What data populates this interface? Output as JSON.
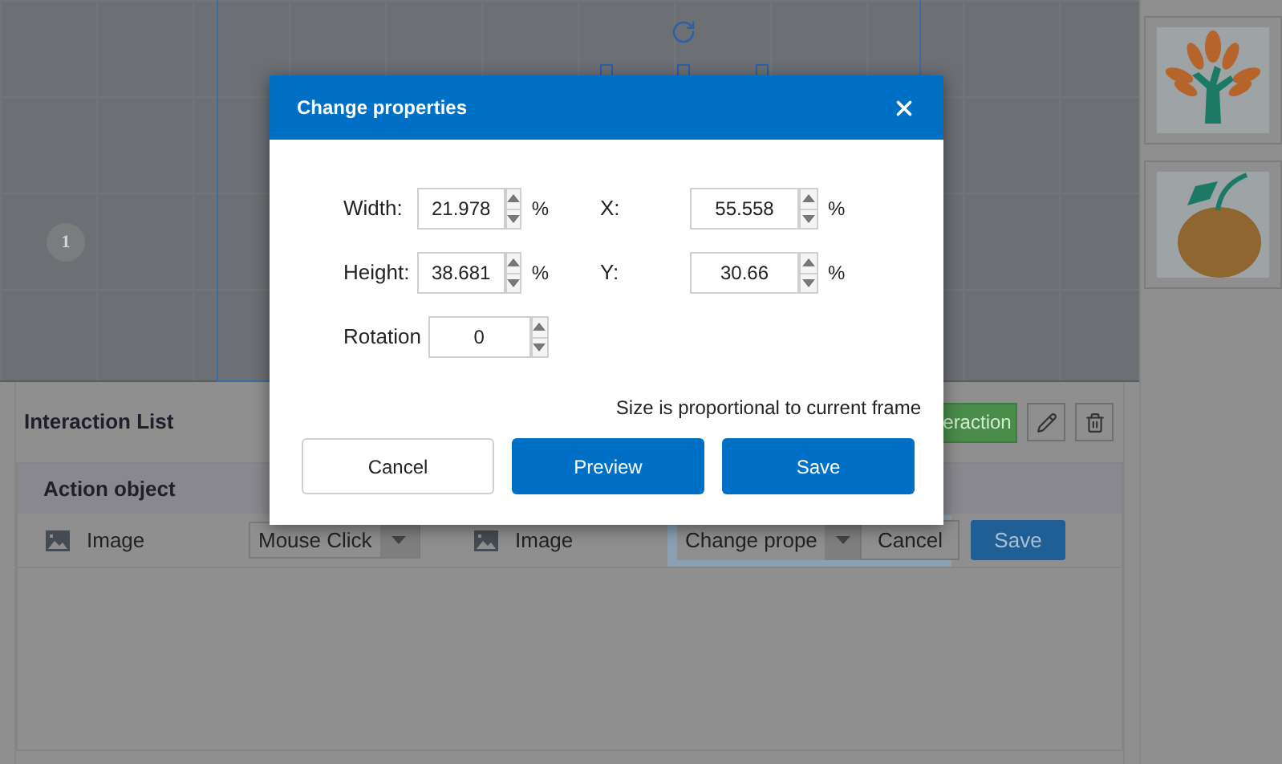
{
  "canvas": {
    "badge": "1"
  },
  "thumbnails": [
    {
      "kind": "tree"
    },
    {
      "kind": "orange"
    }
  ],
  "panel": {
    "title": "Interaction List",
    "add_button": "eraction",
    "columns": [
      "Action object"
    ],
    "rows": [
      {
        "object": "Image",
        "trigger": "Mouse Click",
        "target": "Image",
        "action": "Change prope",
        "cancel": "Cancel",
        "save": "Save"
      }
    ]
  },
  "dialog": {
    "title": "Change properties",
    "rows": [
      [
        {
          "label": "Width:",
          "value": "21.978",
          "unit": "%"
        },
        {
          "label": "X:",
          "value": "55.558",
          "unit": "%"
        }
      ],
      [
        {
          "label": "Height:",
          "value": "38.681",
          "unit": "%"
        },
        {
          "label": "Y:",
          "value": "30.66",
          "unit": "%"
        }
      ],
      [
        {
          "label": "Rotation",
          "value": "0"
        }
      ]
    ],
    "note": "Size is proportional to current frame",
    "buttons": [
      {
        "label": "Cancel",
        "kind": "secondary"
      },
      {
        "label": "Preview",
        "kind": "primary"
      },
      {
        "label": "Save",
        "kind": "primary"
      }
    ]
  }
}
